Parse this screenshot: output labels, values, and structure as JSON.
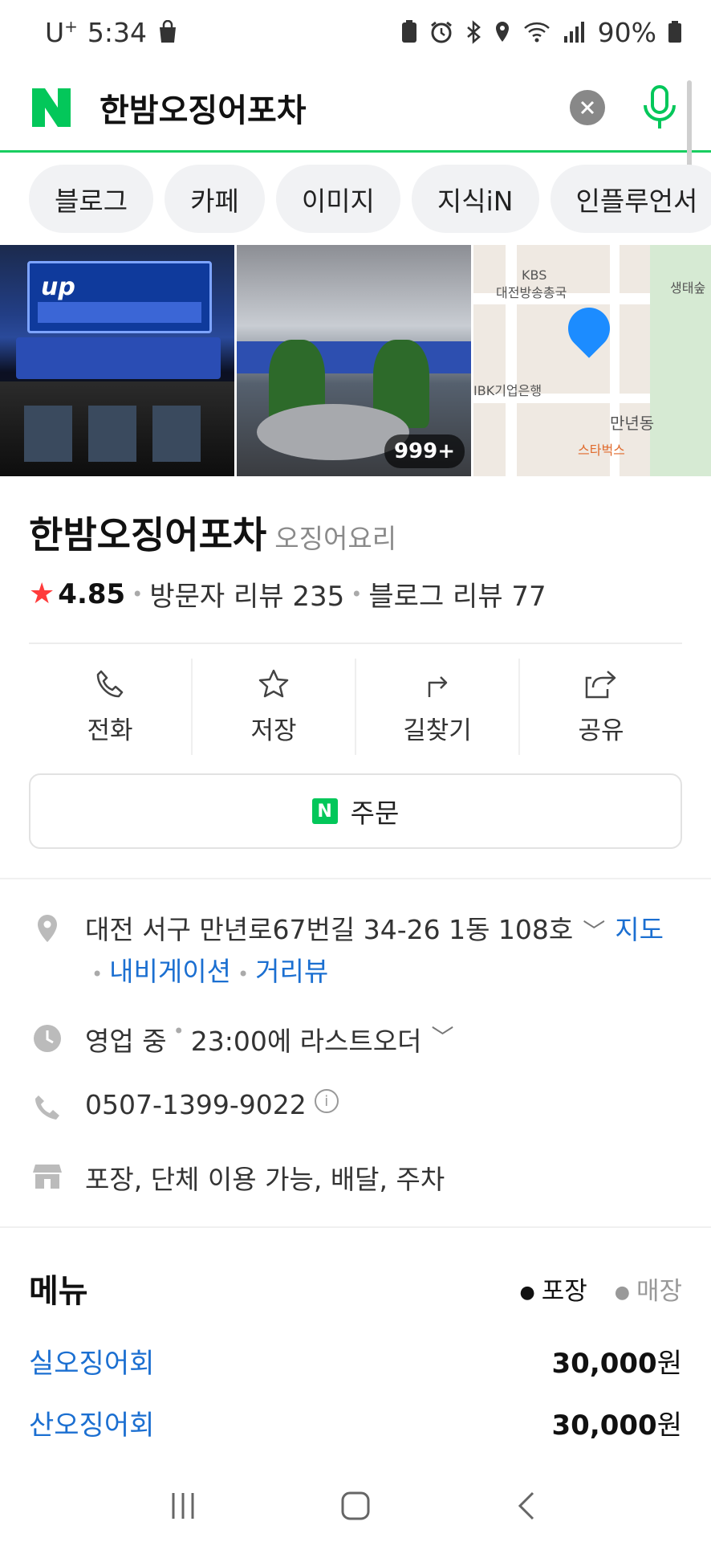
{
  "status_bar": {
    "carrier": "U",
    "carrier_sup": "+",
    "time": "5:34",
    "battery": "90%"
  },
  "search": {
    "logo": "N",
    "query": "한밤오징어포차"
  },
  "chips": [
    "블로그",
    "카페",
    "이미지",
    "지식iN",
    "인플루언서"
  ],
  "photos": {
    "photo1_sign": "up",
    "photo2_count": "999+"
  },
  "map_labels": {
    "kbs": "KBS",
    "kbs_sub": "대전방송총국",
    "ibk": "IBK기업은행",
    "manyeon": "만년동",
    "starbucks": "스타벅스",
    "park": "생태숲"
  },
  "place": {
    "name": "한밤오징어포차",
    "category": "오징어요리",
    "rating": "4.85",
    "visitor_reviews": "방문자 리뷰 235",
    "blog_reviews": "블로그 리뷰 77"
  },
  "actions": [
    "전화",
    "저장",
    "길찾기",
    "공유"
  ],
  "order_label": "주문",
  "order_badge": "N",
  "info": {
    "address": "대전 서구 만년로67번길 34-26 1동 108호",
    "map_link": "지도",
    "navigation_link": "내비게이션",
    "street_view_link": "거리뷰",
    "hours_status": "영업 중",
    "hours_detail": "23:00에 라스트오더",
    "phone": "0507-1399-9022",
    "services": "포장, 단체 이용 가능, 배달, 주차"
  },
  "menu": {
    "title": "메뉴",
    "tab_active": "포장",
    "tab_inactive": "매장",
    "items": [
      {
        "name": "실오징어회",
        "price": "30,000",
        "unit": "원"
      },
      {
        "name": "산오징어회",
        "price": "30,000",
        "unit": "원"
      }
    ]
  },
  "colors": {
    "naver_green": "#19ce60",
    "link_blue": "#1b6fd1",
    "star_red": "#ff3b3b"
  }
}
